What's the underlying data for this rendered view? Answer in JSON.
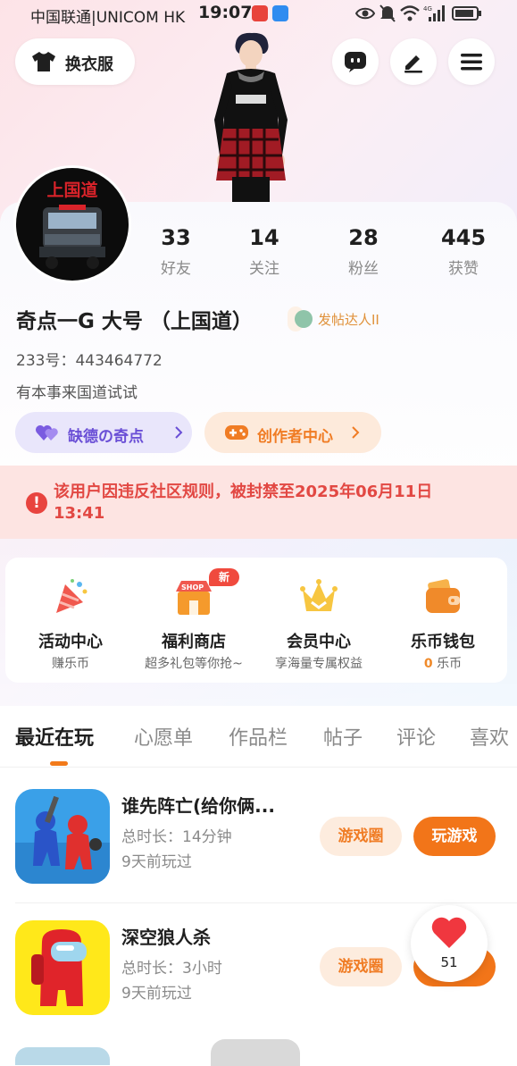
{
  "status_bar": {
    "carrier": "中国联通|UNICOM HK",
    "time": "19:07",
    "network": "4G"
  },
  "header": {
    "outfit_label": "换衣服",
    "icons": [
      "tshirt-icon",
      "message-icon",
      "edit-icon",
      "menu-icon"
    ]
  },
  "profile": {
    "avatar_text": "上国道",
    "stats": [
      {
        "num": "33",
        "label": "好友"
      },
      {
        "num": "14",
        "label": "关注"
      },
      {
        "num": "28",
        "label": "粉丝"
      },
      {
        "num": "445",
        "label": "获赞"
      }
    ],
    "name": "奇点一G 大号 （上国道）",
    "badge": "发帖达人II",
    "uid": "233号：443464772",
    "bio": "有本事来国道试试",
    "pill_left": "缺德の奇点",
    "pill_right": "创作者中心"
  },
  "warning": {
    "text": "该用户因违反社区规则，被封禁至2025年06月11日13:41"
  },
  "features": [
    {
      "title": "活动中心",
      "sub": "赚乐币"
    },
    {
      "title": "福利商店",
      "sub": "超多礼包等你抢~",
      "tag": "新"
    },
    {
      "title": "会员中心",
      "sub": "享海量专属权益"
    },
    {
      "title": "乐币钱包",
      "sub_value": "0",
      "sub_unit": "乐币"
    }
  ],
  "tabs": [
    "最近在玩",
    "心愿单",
    "作品栏",
    "帖子",
    "评论",
    "喜欢"
  ],
  "games": [
    {
      "title": "谁先阵亡(给你俩...",
      "duration": "总时长：14分钟",
      "ago": "9天前玩过",
      "circle_label": "游戏圈",
      "play_label": "玩游戏"
    },
    {
      "title": "深空狼人杀",
      "duration": "总时长：3小时",
      "ago": "9天前玩过",
      "circle_label": "游戏圈"
    }
  ],
  "fab": {
    "count": "51"
  },
  "colors": {
    "accent": "#f27519",
    "warning": "#e24843",
    "purple_pill": "#e9e6fb"
  }
}
